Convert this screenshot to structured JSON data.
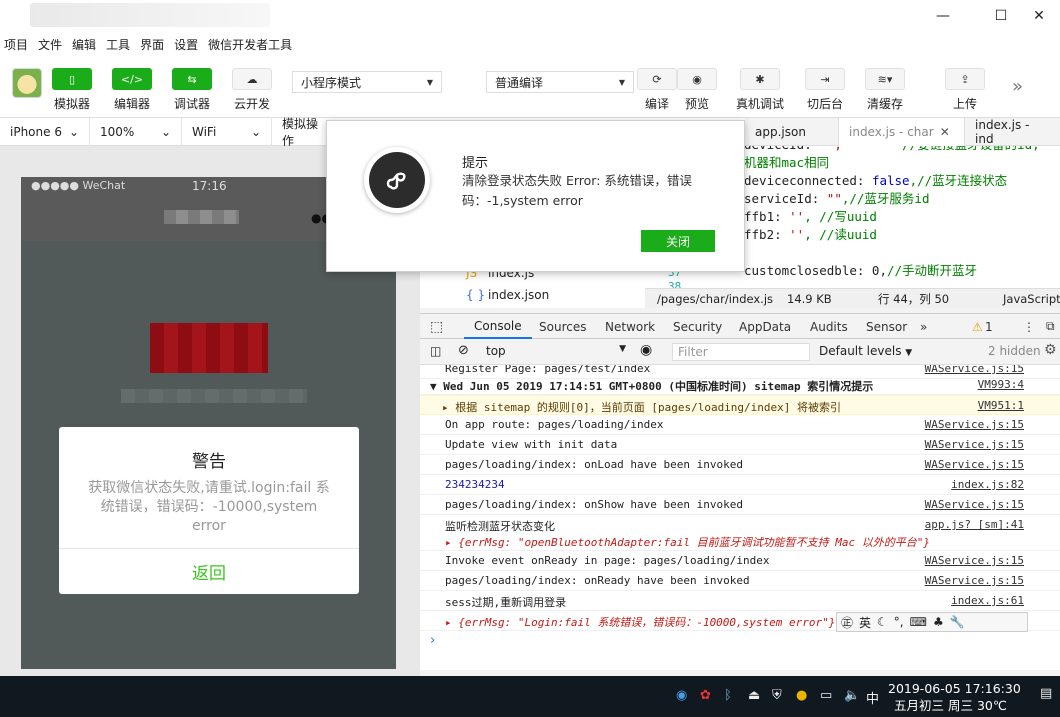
{
  "menu": [
    "项目",
    "文件",
    "编辑",
    "工具",
    "界面",
    "设置",
    "微信开发者工具"
  ],
  "toolbar": {
    "simulator": "模拟器",
    "editor": "编辑器",
    "debugger": "调试器",
    "cloud": "云开发",
    "mode_select": "小程序模式",
    "compile_select": "普通编译",
    "compile": "编译",
    "preview": "预览",
    "remote_debug": "真机调试",
    "background": "切后台",
    "clear_cache": "清缓存",
    "upload": "上传"
  },
  "simbar": {
    "device": "iPhone 6",
    "zoom": "100%",
    "network": "WiFi",
    "sim_op": "模拟操作"
  },
  "phone": {
    "carrier": "●●●●● WeChat",
    "time": "17:16",
    "alert_title": "警告",
    "alert_msg": "获取微信状态失败,请重试.login:fail 系统错误，错误码：-10000,system error",
    "alert_btn": "返回"
  },
  "tabs": [
    "app.json",
    "index.js - char",
    "index.js - ind"
  ],
  "code": {
    "line1_a": "deviceId: ",
    "line1_cmt": "//要链接蓝牙设备的id,",
    "line2_cmt": "机器和mac相同",
    "line3_a": "deviceconnected: ",
    "line3_kw": "false",
    "line3_cmt": ",//蓝牙连接状态",
    "line4_a": "serviceId: ",
    "line4_str": "\"\"",
    "line4_cmt": ",//蓝牙服务id",
    "line5_a": "ffb1: ",
    "line5_str": "''",
    "line5_cmt": ", //写uuid",
    "line6_a": "ffb2: ",
    "line6_str": "''",
    "line6_cmt": ", //读uuid",
    "line8_a": "customclosedble: 0,",
    "line8_cmt": "//手动断开蓝牙",
    "gutter1": "37",
    "gutter2": "38"
  },
  "filetree": [
    "index.js",
    "index.json"
  ],
  "statusbar": {
    "path": "/pages/char/index.js",
    "size": "14.9 KB",
    "position": "行 44，列 50",
    "lang": "JavaScript"
  },
  "devtools": {
    "tabs": [
      "Console",
      "Sources",
      "Network",
      "Security",
      "AppData",
      "Audits",
      "Sensor"
    ],
    "warn_count": "1",
    "context": "top",
    "filter_placeholder": "Filter",
    "levels": "Default levels",
    "hidden": "2 hidden"
  },
  "console": [
    {
      "text": "Register Page: pages/test/index",
      "src": "WAService.js:15"
    },
    {
      "text": "▼ Wed Jun 05 2019 17:14:51 GMT+0800 (中国标准时间) sitemap 索引情况提示",
      "src": "VM993:4"
    },
    {
      "text": "▸ 根据 sitemap 的规则[0]，当前页面 [pages/loading/index] 将被索引",
      "src": "VM951:1"
    },
    {
      "text": "On app route: pages/loading/index",
      "src": "WAService.js:15"
    },
    {
      "text": "Update view with init data",
      "src": "WAService.js:15"
    },
    {
      "text": "pages/loading/index: onLoad have been invoked",
      "src": "WAService.js:15"
    },
    {
      "text": "234234234",
      "src": "index.js:82"
    },
    {
      "text": "pages/loading/index: onShow have been invoked",
      "src": "WAService.js:15"
    },
    {
      "text": "监听检测蓝牙状态变化",
      "src": "app.js? [sm]:41"
    },
    {
      "text": "▸ {errMsg: \"openBluetoothAdapter:fail 目前蓝牙调试功能暂不支持 Mac 以外的平台\"}",
      "src": ""
    },
    {
      "text": "Invoke event onReady in page: pages/loading/index",
      "src": "WAService.js:15"
    },
    {
      "text": "pages/loading/index: onReady have been invoked",
      "src": "WAService.js:15"
    },
    {
      "text": "sess过期,重新调用登录",
      "src": "index.js:61"
    },
    {
      "text": "▸ {errMsg: \"Login:fail 系统错误，错误码：-10000,system error\"}",
      "src": "k.js:71"
    }
  ],
  "dialog": {
    "title": "提示",
    "message": "清除登录状态失败 Error: 系统错误，错误码：-1,system error",
    "button": "关闭"
  },
  "ime": "英",
  "taskbar": {
    "ime_lang": "中",
    "date": "2019-06-05",
    "time": "17:16:30",
    "lunar": "五月初三 周三",
    "weather": "30℃"
  }
}
